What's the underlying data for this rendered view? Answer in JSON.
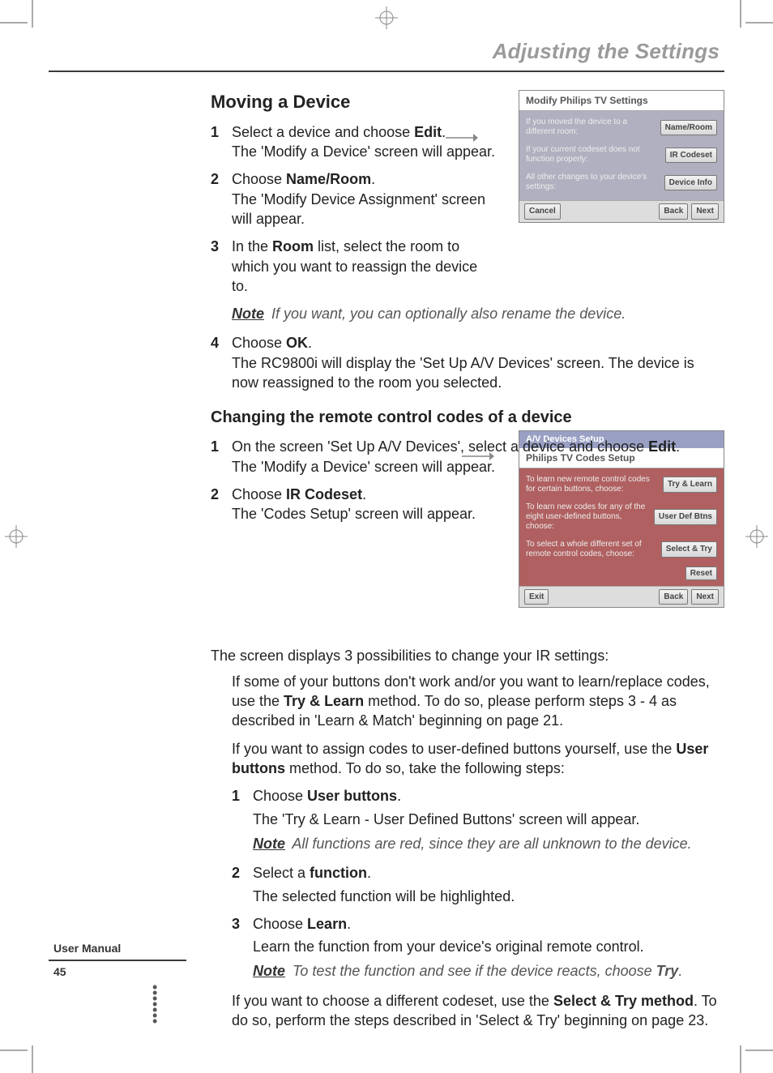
{
  "header": {
    "section": "Adjusting the Settings"
  },
  "section1": {
    "title": "Moving a Device",
    "s1_num": "1",
    "s1_line1_a": "Select a device and choose ",
    "s1_bold": "Edit",
    "s1_line1_b": ".",
    "s1_line2": "The 'Modify a Device' screen will appear.",
    "s2_num": "2",
    "s2_line1_a": "Choose ",
    "s2_bold": "Name/Room",
    "s2_line1_b": ".",
    "s2_line2": "The 'Modify Device Assignment' screen will appear.",
    "s3_num": "3",
    "s3_line1_a": "In the ",
    "s3_bold": "Room",
    "s3_line1_b": " list, select the room to which you want to reassign the device to.",
    "note1_label": "Note",
    "note1": " If you want, you can optionally also rename the device.",
    "s4_num": "4",
    "s4_line1_a": "Choose ",
    "s4_bold": "OK",
    "s4_line1_b": ".",
    "s4_line2": "The RC9800i will display the 'Set Up A/V Devices' screen. The device is now reassigned to the room you selected."
  },
  "section2": {
    "title": "Changing the remote control codes of a device",
    "s1_num": "1",
    "s1_line1_a": "On the screen 'Set Up A/V Devices', select a device and choose ",
    "s1_bold": "Edit",
    "s1_line1_b": ".",
    "s1_line2": "The 'Modify a Device' screen will appear.",
    "s2_num": "2",
    "s2_line1_a": "Choose ",
    "s2_bold": "IR Codeset",
    "s2_line1_b": ".",
    "s2_line2": "The 'Codes Setup' screen will appear.",
    "intro": "The screen displays 3 possibilities to change your IR settings:",
    "p1_a": "If some of your buttons don't work and/or you want to learn/replace codes, use the ",
    "p1_bold": "Try & Learn",
    "p1_b": " method. To do so, please perform steps 3 - 4 as described in 'Learn & Match' beginning on page 21.",
    "p2_a": "If you want to assign codes to user-defined buttons yourself, use the ",
    "p2_bold": "User buttons",
    "p2_b": " method. To do so, take the following steps:",
    "sub1_num": "1",
    "sub1_a": "Choose ",
    "sub1_bold": "User buttons",
    "sub1_b": ".",
    "sub1_line2": "The 'Try & Learn - User Defined Buttons' screen will appear.",
    "sub1_note_label": "Note",
    "sub1_note": " All functions are red, since they are all unknown to the device.",
    "sub2_num": "2",
    "sub2_a": "Select a ",
    "sub2_bold": "function",
    "sub2_b": ".",
    "sub2_line2": "The selected function will be highlighted.",
    "sub3_num": "3",
    "sub3_a": "Choose ",
    "sub3_bold": "Learn",
    "sub3_b": ".",
    "sub3_line2": "Learn the function from your device's original remote control.",
    "sub3_note_label": "Note",
    "sub3_note_a": " To test the function and see if the device reacts, choose ",
    "sub3_note_bold": "Try",
    "sub3_note_b": ".",
    "p3_a": "If you want to choose a different codeset, use the ",
    "p3_bold": "Select & Try method",
    "p3_b": ". To do so, perform the steps described in 'Select & Try' beginning on page 23."
  },
  "fig1": {
    "title": "Modify Philips TV Settings",
    "r1_text": "If you moved the device to a different room:",
    "r1_btn": "Name/Room",
    "r2_text": "If your current codeset does not function properly:",
    "r2_btn": "IR Codeset",
    "r3_text": "All other changes to your device's settings:",
    "r3_btn": "Device Info",
    "f_cancel": "Cancel",
    "f_back": "Back",
    "f_next": "Next"
  },
  "fig2": {
    "header": "A/V Devices Setup",
    "title": "Philips TV Codes Setup",
    "r1_text": "To learn new remote control codes for certain buttons, choose:",
    "r1_btn": "Try & Learn",
    "r2_text": "To learn new codes for any of the eight user-defined buttons, choose:",
    "r2_btn": "User Def Btns",
    "r3_text": "To select a whole different set of remote control codes, choose:",
    "r3_btn": "Select & Try",
    "f_res": "Reset",
    "f_exit": "Exit",
    "f_back": "Back",
    "f_next": "Next"
  },
  "sidebar": {
    "label": "User Manual",
    "page": "45"
  }
}
